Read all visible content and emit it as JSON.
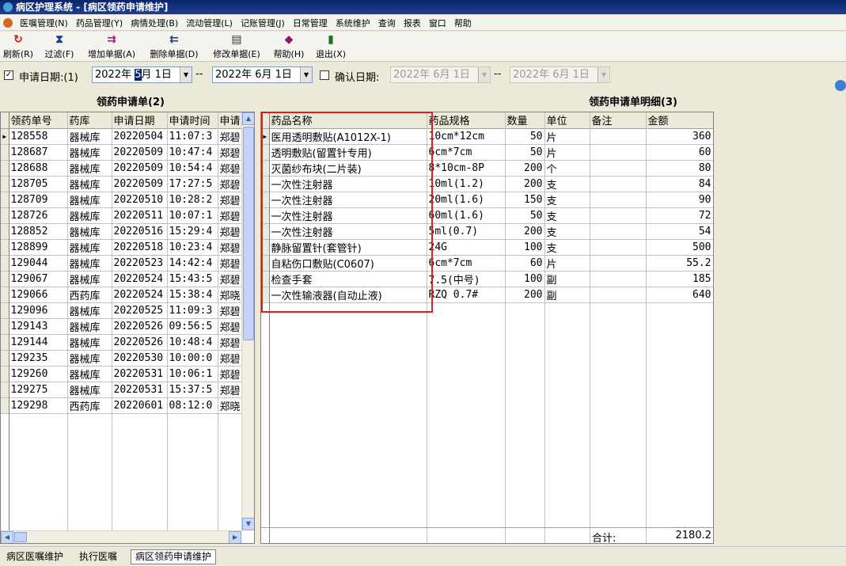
{
  "window": {
    "title": "病区护理系统 - [病区领药申请维护]"
  },
  "menu": [
    "医嘱管理(N)",
    "药品管理(Y)",
    "病情处理(B)",
    "流动管理(L)",
    "记账管理(J)",
    "日常管理",
    "系统维护",
    "查询",
    "报表",
    "窗口",
    "帮助"
  ],
  "toolbar": {
    "refresh": "刷新(R)",
    "filter": "过滤(F)",
    "add": "增加单据(A)",
    "delete": "删除单据(D)",
    "modify": "修改单据(E)",
    "help": "帮助(H)",
    "exit": "退出(X)"
  },
  "filters": {
    "apply_label": "申请日期:(1)",
    "apply_from_year": "2022年",
    "apply_from_month": "5",
    "apply_from_rest": "月 1日",
    "apply_to": "2022年 6月 1日",
    "sep": "--",
    "confirm_label": "确认日期:",
    "confirm_from": "2022年 6月 1日",
    "confirm_to": "2022年 6月 1日",
    "apply_checked": "✓"
  },
  "left": {
    "title": "领药申请单(2)",
    "columns": [
      "领药单号",
      "药库",
      "申请日期",
      "申请时间",
      "申请"
    ],
    "rows": [
      [
        "128558",
        "器械库",
        "20220504",
        "11:07:3",
        "郑碧"
      ],
      [
        "128687",
        "器械库",
        "20220509",
        "10:47:4",
        "郑碧"
      ],
      [
        "128688",
        "器械库",
        "20220509",
        "10:54:4",
        "郑碧"
      ],
      [
        "128705",
        "器械库",
        "20220509",
        "17:27:5",
        "郑碧"
      ],
      [
        "128709",
        "器械库",
        "20220510",
        "10:28:2",
        "郑碧"
      ],
      [
        "128726",
        "器械库",
        "20220511",
        "10:07:1",
        "郑碧"
      ],
      [
        "128852",
        "器械库",
        "20220516",
        "15:29:4",
        "郑碧"
      ],
      [
        "128899",
        "器械库",
        "20220518",
        "10:23:4",
        "郑碧"
      ],
      [
        "129044",
        "器械库",
        "20220523",
        "14:42:4",
        "郑碧"
      ],
      [
        "129067",
        "器械库",
        "20220524",
        "15:43:5",
        "郑碧"
      ],
      [
        "129066",
        "西药库",
        "20220524",
        "15:38:4",
        "郑晓"
      ],
      [
        "129096",
        "器械库",
        "20220525",
        "11:09:3",
        "郑碧"
      ],
      [
        "129143",
        "器械库",
        "20220526",
        "09:56:5",
        "郑碧"
      ],
      [
        "129144",
        "器械库",
        "20220526",
        "10:48:4",
        "郑碧"
      ],
      [
        "129235",
        "器械库",
        "20220530",
        "10:00:0",
        "郑碧"
      ],
      [
        "129260",
        "器械库",
        "20220531",
        "10:06:1",
        "郑碧"
      ],
      [
        "129275",
        "器械库",
        "20220531",
        "15:37:5",
        "郑碧"
      ],
      [
        "129298",
        "西药库",
        "20220601",
        "08:12:0",
        "郑晓"
      ]
    ]
  },
  "right": {
    "title": "领药申请单明细(3)",
    "columns": [
      "药品名称",
      "药品规格",
      "数量",
      "单位",
      "备注",
      "金额"
    ],
    "rows": [
      [
        "医用透明敷贴(A1012X-1)",
        "10cm*12cm",
        "50",
        "片",
        "",
        "360"
      ],
      [
        "透明敷贴(留置针专用)",
        "6cm*7cm",
        "50",
        "片",
        "",
        "60"
      ],
      [
        "灭菌纱布块(二片装)",
        "8*10cm-8P",
        "200",
        "个",
        "",
        "80"
      ],
      [
        "一次性注射器",
        "10ml(1.2)",
        "200",
        "支",
        "",
        "84"
      ],
      [
        "一次性注射器",
        "20ml(1.6)",
        "150",
        "支",
        "",
        "90"
      ],
      [
        "一次性注射器",
        "60ml(1.6)",
        "50",
        "支",
        "",
        "72"
      ],
      [
        "一次性注射器",
        "5ml(0.7)",
        "200",
        "支",
        "",
        "54"
      ],
      [
        "静脉留置针(套管针)",
        "24G",
        "100",
        "支",
        "",
        "500"
      ],
      [
        "自粘伤口敷贴(C0607)",
        "6cm*7cm",
        "60",
        "片",
        "",
        "55.2"
      ],
      [
        "检查手套",
        "7.5(中号)",
        "100",
        "副",
        "",
        "185"
      ],
      [
        "一次性输液器(自动止液)",
        "RZQ 0.7#",
        "200",
        "副",
        "",
        "640"
      ]
    ],
    "total_label": "合计:",
    "total_value": "2180.2"
  },
  "status_tabs": [
    "病区医嘱维护",
    "执行医嘱",
    "病区领药申请维护"
  ],
  "colors": {
    "titlebar": "#0a246a",
    "highlight_box": "#e02020"
  }
}
